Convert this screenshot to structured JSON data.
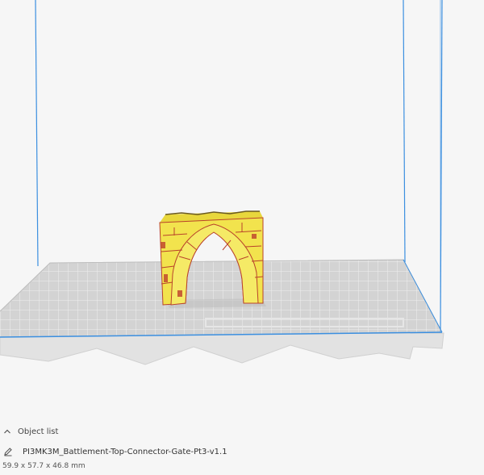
{
  "object_panel": {
    "toggle_label": "Object list",
    "object_name": "PI3MK3M_Battlement-Top-Connector-Gate-Pt3-v1.1",
    "dimensions": "59.9 x 57.7 x 46.8 mm"
  },
  "colors": {
    "background": "#f6f6f6",
    "build_volume_lines": "#3b8fe0",
    "build_plate_fill": "#d3d3d3",
    "build_plate_grid": "#eeeeee",
    "model_fill": "#f2e34d",
    "model_shadow": "#b9432b"
  },
  "icons": {
    "toggle": "chevron-up-icon",
    "edit": "pencil-icon"
  }
}
